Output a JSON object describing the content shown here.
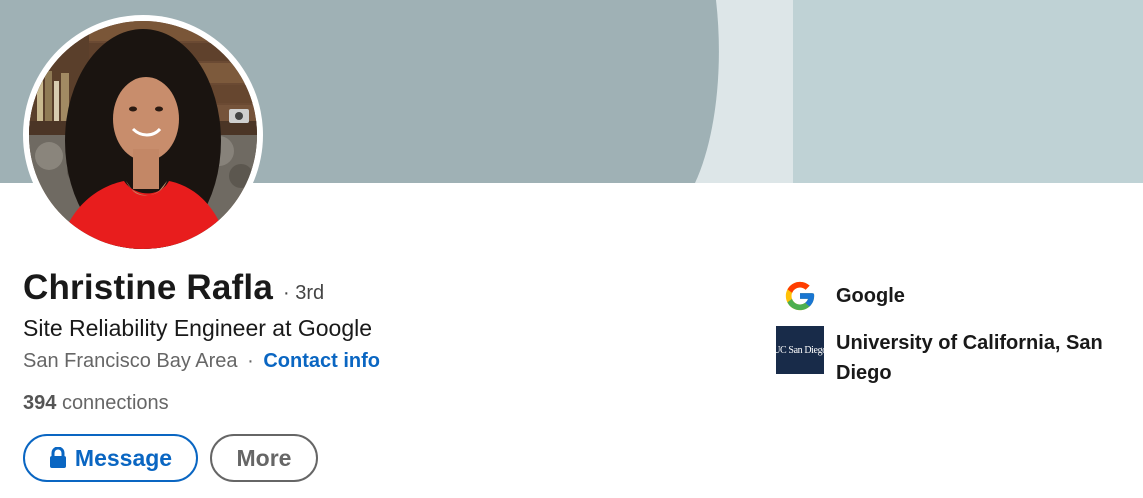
{
  "profile": {
    "name": "Christine Rafla",
    "degree": "· 3rd",
    "headline": "Site Reliability Engineer at Google",
    "location": "San Francisco Bay Area",
    "separator": "·",
    "contact_info": "Contact info",
    "connections_count": "394",
    "connections_label": "connections"
  },
  "actions": {
    "message_label": "Message",
    "more_label": "More"
  },
  "experience": {
    "company": "Google",
    "company_icon": "google-logo",
    "school": "University of California, San Diego",
    "school_logo_text": "UC San Diego"
  },
  "colors": {
    "accent": "#0a66c2",
    "banner": "#9fb1b5",
    "text_primary": "#191919",
    "text_secondary": "#666666"
  }
}
